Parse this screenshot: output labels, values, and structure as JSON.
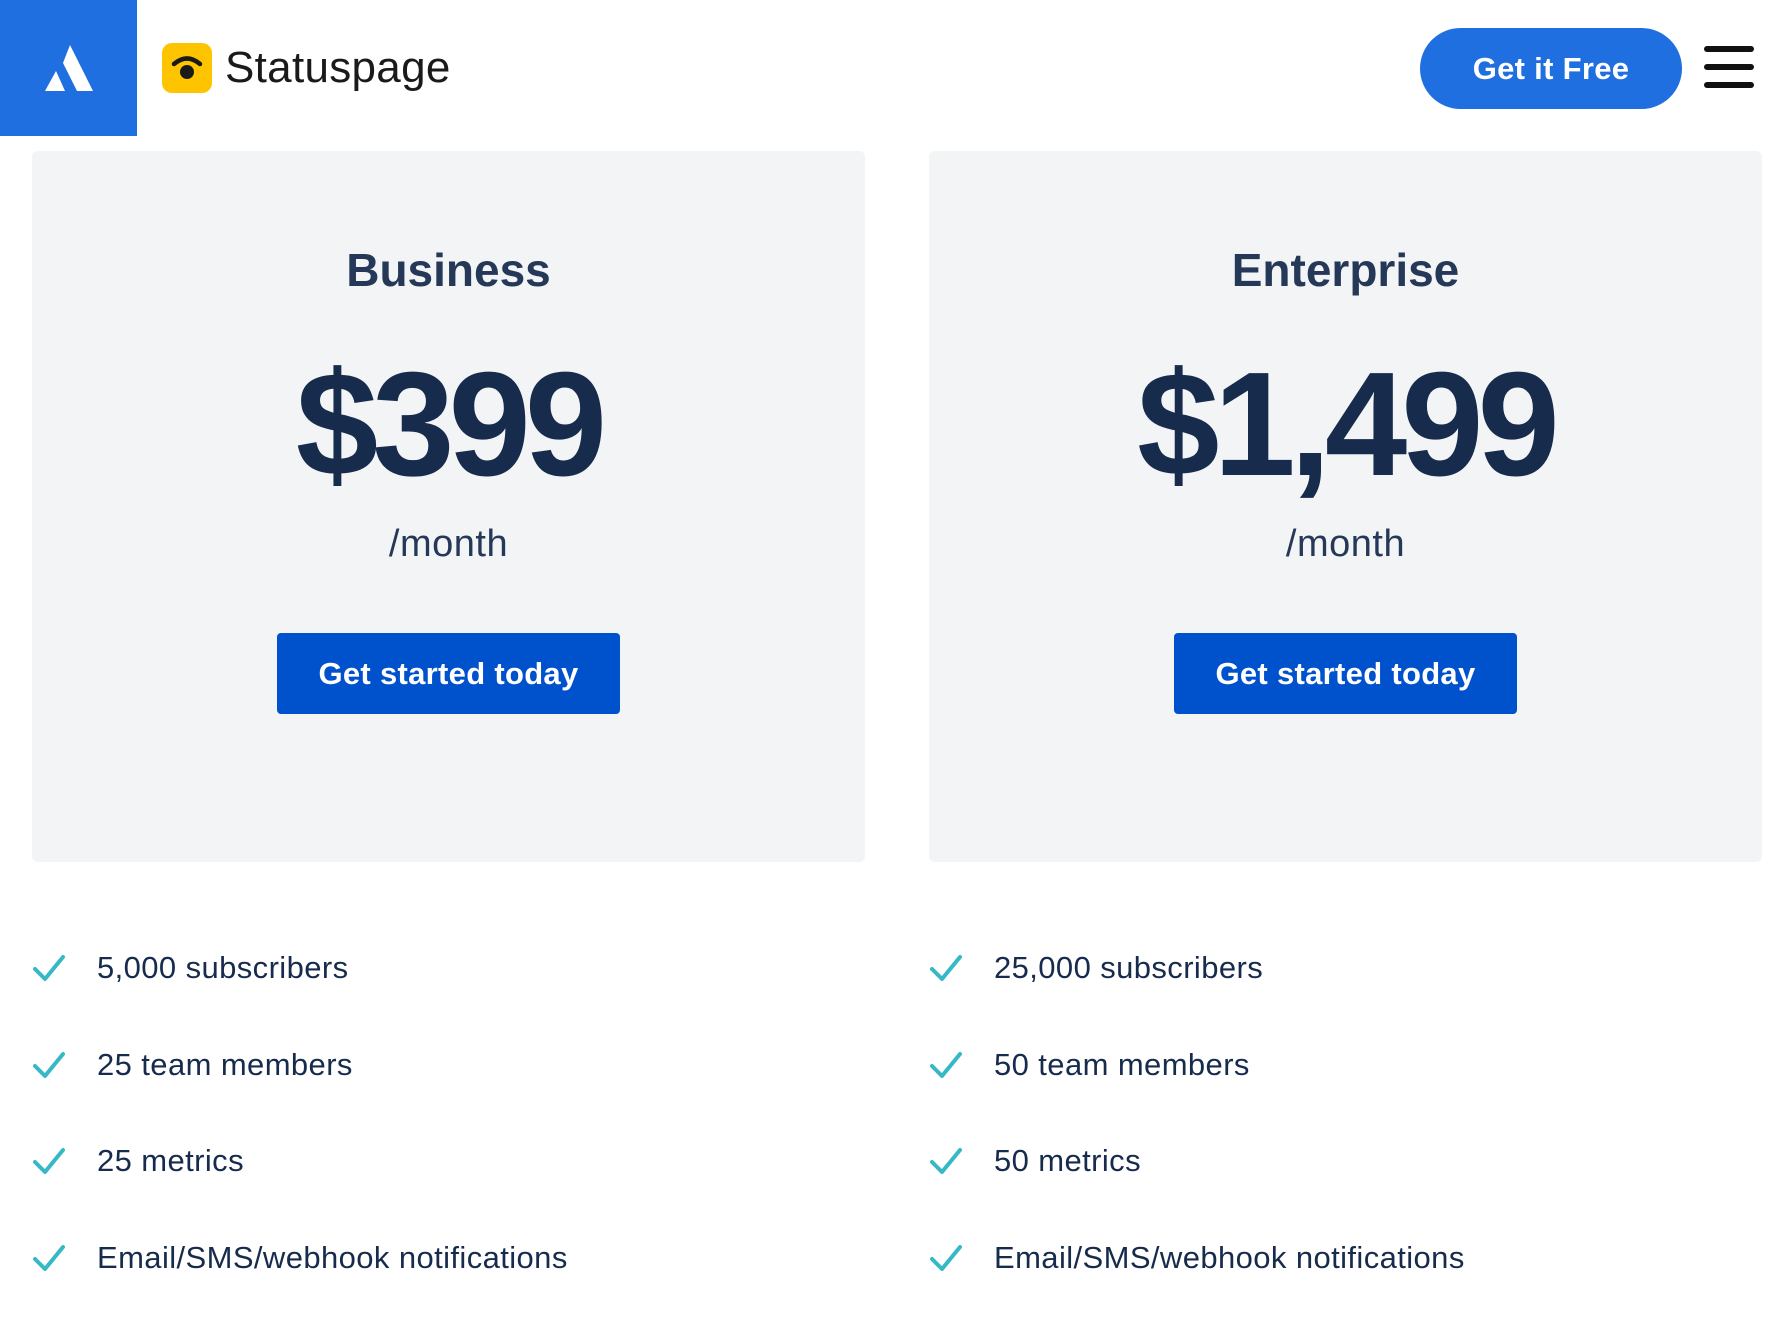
{
  "header": {
    "atlassian_logo": "atlassian-logo-icon",
    "brand_icon": "statuspage-icon",
    "brand_name": "Statuspage",
    "cta_label": "Get it Free",
    "menu_icon": "hamburger-menu-icon"
  },
  "plans": [
    {
      "name": "Business",
      "price": "$399",
      "period": "/month",
      "button_label": "Get started today",
      "features": [
        "5,000 subscribers",
        "25 team members",
        "25 metrics",
        "Email/SMS/webhook notifications"
      ]
    },
    {
      "name": "Enterprise",
      "price": "$1,499",
      "period": "/month",
      "button_label": "Get started today",
      "features": [
        "25,000 subscribers",
        "50 team members",
        "50 metrics",
        "Email/SMS/webhook notifications"
      ]
    }
  ],
  "colors": {
    "primary_blue": "#0052cc",
    "header_blue": "#1f6fe0",
    "brand_yellow": "#ffc400",
    "check_teal": "#36b8c5",
    "card_bg": "#f3f4f6",
    "text_dark": "#172b4d"
  }
}
